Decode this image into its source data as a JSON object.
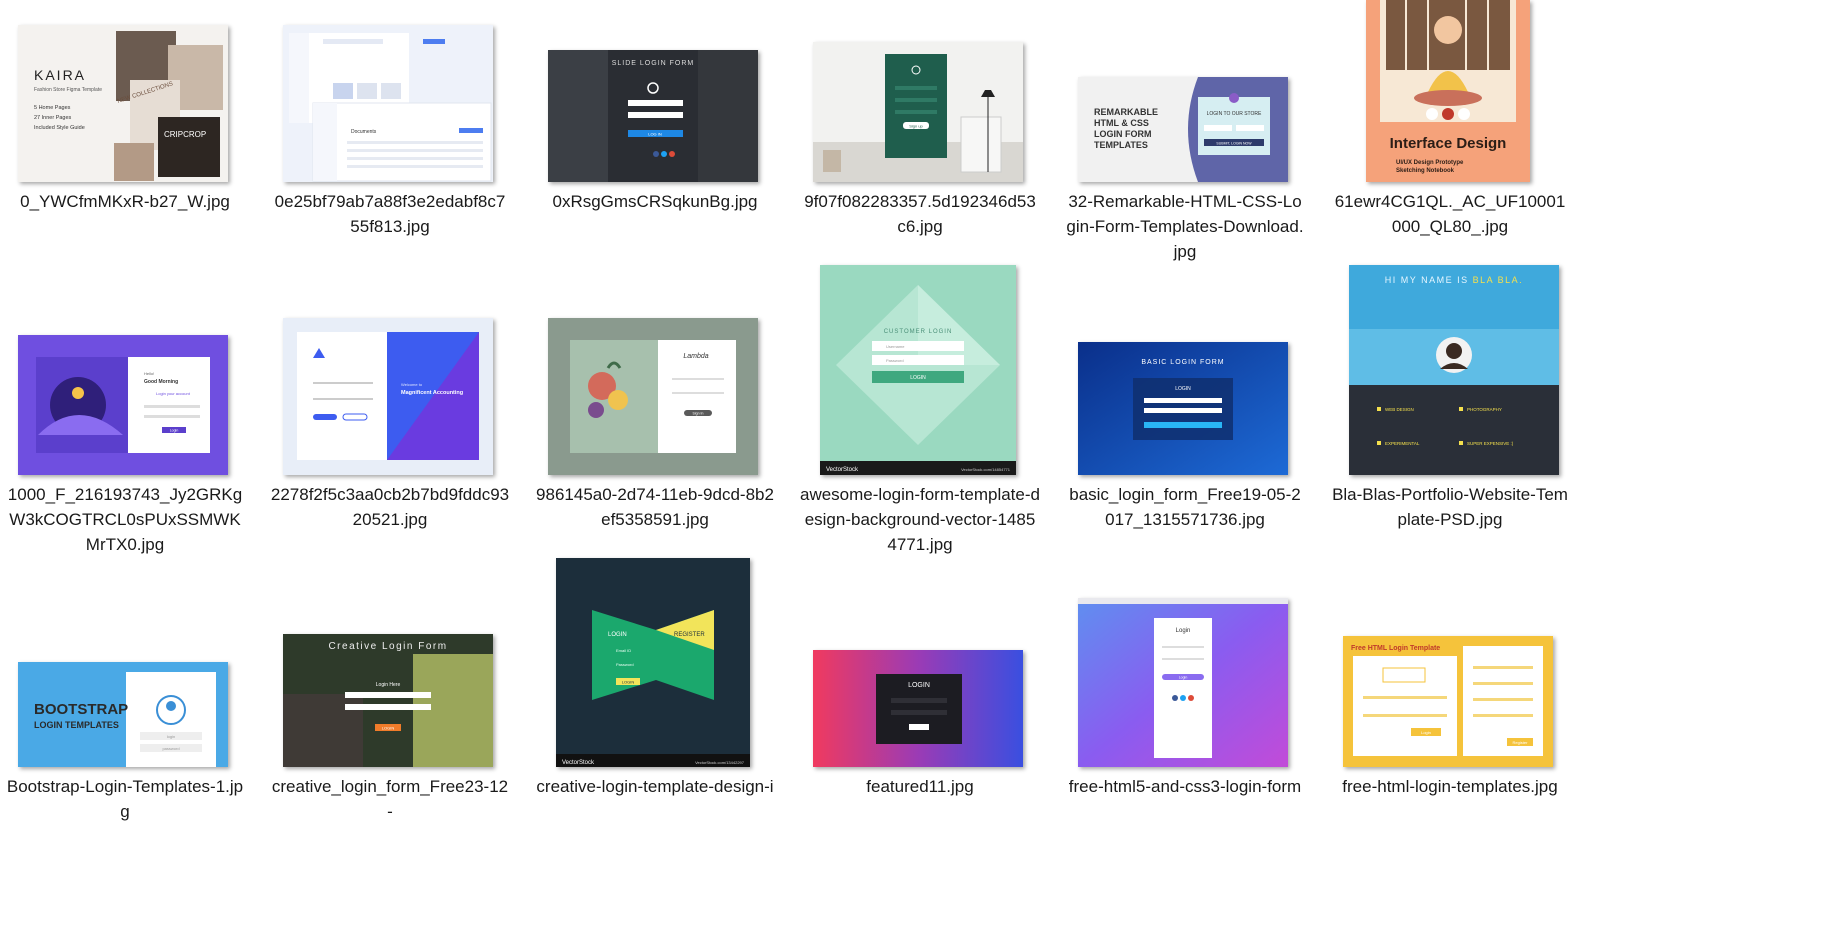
{
  "files": [
    {
      "name": "0_YWCfmMKxR-b27_W.jpg",
      "thumb": {
        "brand": "KAIRA",
        "sub": "Fashion Store Figma Template",
        "lines": [
          "5 Home Pages",
          "27 Inner Pages",
          "Included Style Guide"
        ],
        "tag": "NEW COLLECTIONS",
        "tag2": "CRIPCROP"
      }
    },
    {
      "name": "0e25bf79ab7a88f3e2edabf8c755f813.jpg",
      "thumb": {
        "heading": "Documents"
      }
    },
    {
      "name": "0xRsgGmsCRSqkunBg.jpg",
      "thumb": {
        "heading": "SLIDE LOGIN FORM",
        "button": "LOG IN"
      }
    },
    {
      "name": "9f07f082283357.5d192346d53c6.jpg",
      "thumb": {
        "button": "Sign up"
      }
    },
    {
      "name": "32-Remarkable-HTML-CSS-Login-Form-Templates-Download.jpg",
      "thumb": {
        "lines": [
          "REMARKABLE",
          "HTML & CSS",
          "LOGIN FORM",
          "TEMPLATES"
        ],
        "card": "LOGIN TO OUR STORE",
        "button": "SUBMIT, LOGIN NOW"
      }
    },
    {
      "name": "61ewr4CG1QL._AC_UF10001000_QL80_.jpg",
      "thumb": {
        "title": "Interface Design",
        "sub": "UI/UX Design Prototype",
        "sub2": "Sketching Notebook"
      }
    },
    {
      "name": "1000_F_216193743_Jy2GRKgW3kCOGTRCL0sPUxSSMWKMrTX0.jpg",
      "thumb": {
        "hello": "Hello!",
        "greet": "Good Morning",
        "line": "Login your account",
        "button": "Login"
      }
    },
    {
      "name": "2278f2f5c3aa0cb2b7bd9fddc9320521.jpg",
      "thumb": {
        "welcome": "Welcome to",
        "brand": "Magnificent Accounting"
      }
    },
    {
      "name": "986145a0-2d74-11eb-9dcd-8b2ef5358591.jpg",
      "thumb": {
        "brand": "Lambda",
        "button": "Sign In"
      }
    },
    {
      "name": "awesome-login-form-template-design-background-vector-14854771.jpg",
      "thumb": {
        "heading": "CUSTOMER LOGIN",
        "f1": "Username",
        "f2": "Password",
        "button": "LOGIN",
        "stock": "VectorStock",
        "url": "VectorStock.com/14854771"
      }
    },
    {
      "name": "basic_login_form_Free19-05-2017_1315571736.jpg",
      "thumb": {
        "heading": "BASIC LOGIN FORM",
        "card": "LOGIN"
      }
    },
    {
      "name": "Bla-Blas-Portfolio-Website-Template-PSD.jpg",
      "thumb": {
        "heading": "HI MY NAME IS ",
        "accent": "BLA BLA.",
        "s1": "WEB DESIGN",
        "s2": "PHOTOGRAPHY",
        "s3": "EXPERIMENTAL",
        "s4": "SUPER EXPENSIVE :)"
      }
    },
    {
      "name": "Bootstrap-Login-Templates-1.jpg",
      "thumb": {
        "l1": "BOOTSTRAP",
        "l2": "LOGIN TEMPLATES",
        "f1": "login",
        "f2": "password"
      }
    },
    {
      "name": "creative_login_form_Free23-12-",
      "thumb": {
        "heading": "Creative Login Form",
        "sub": "Login Here",
        "button": "LOGIN"
      }
    },
    {
      "name": "creative-login-template-design-i",
      "thumb": {
        "t1": "LOGIN",
        "t2": "REGISTER",
        "f1": "Email ID",
        "f2": "Password",
        "button": "LOGIN",
        "stock": "VectorStock",
        "url": "VectorStock.com/13442297"
      }
    },
    {
      "name": "featured11.jpg",
      "thumb": {
        "heading": "LOGIN"
      }
    },
    {
      "name": "free-html5-and-css3-login-form",
      "thumb": {
        "heading": "Login",
        "button": "Login"
      }
    },
    {
      "name": "free-html-login-templates.jpg",
      "thumb": {
        "heading": "Free HTML Login Template",
        "btn1": "Login",
        "btn2": "Register"
      }
    }
  ]
}
